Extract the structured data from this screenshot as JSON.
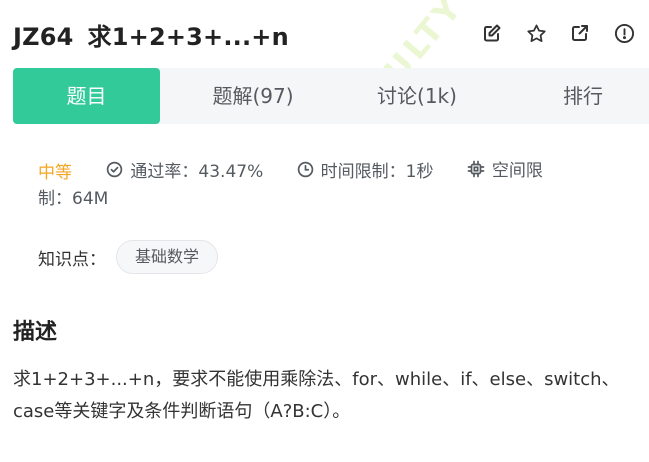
{
  "header": {
    "code": "JZ64",
    "title": "求1+2+3+...+n",
    "icons": [
      "edit-icon",
      "star-icon",
      "external-link-icon",
      "alert-circle-icon"
    ]
  },
  "watermark": "CULTY",
  "tabs": [
    {
      "label": "题目",
      "active": true
    },
    {
      "label": "题解(97)",
      "active": false
    },
    {
      "label": "讨论(1k)",
      "active": false
    },
    {
      "label": "排行",
      "active": false
    }
  ],
  "meta": {
    "difficulty": "中等",
    "pass_rate": "通过率：43.47%",
    "time_limit": "时间限制：1秒",
    "space_limit_part1": "空间限",
    "space_limit_part2": "制：64M"
  },
  "knowledge": {
    "label": "知识点：",
    "tags": [
      "基础数学"
    ]
  },
  "description": {
    "title": "描述",
    "text": "求1+2+3+...+n，要求不能使用乘除法、for、while、if、else、switch、case等关键字及条件判断语句（A?B:C）。"
  },
  "colors": {
    "accent": "#32ca99",
    "difficulty": "#f5a623",
    "tab_bg": "#f5f6f7",
    "text": "#333333"
  }
}
